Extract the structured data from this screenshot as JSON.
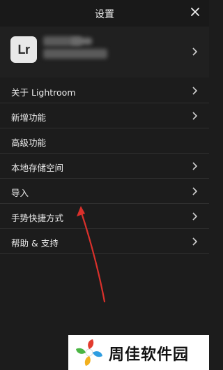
{
  "header": {
    "title": "设置",
    "close_icon": "close-icon"
  },
  "profile": {
    "logo_text": "Lr",
    "account_name_hidden": true
  },
  "menu": [
    {
      "label": "关于 Lightroom"
    },
    {
      "label": "新增功能"
    },
    {
      "label": "高级功能"
    },
    {
      "label": "本地存储空间"
    },
    {
      "label": "导入"
    },
    {
      "label": "手势快捷方式"
    },
    {
      "label": "帮助 & 支持"
    }
  ],
  "watermark": {
    "text": "周佳软件园"
  },
  "colors": {
    "background": "#1c1c1c",
    "annotation_arrow": "#d9302b"
  }
}
